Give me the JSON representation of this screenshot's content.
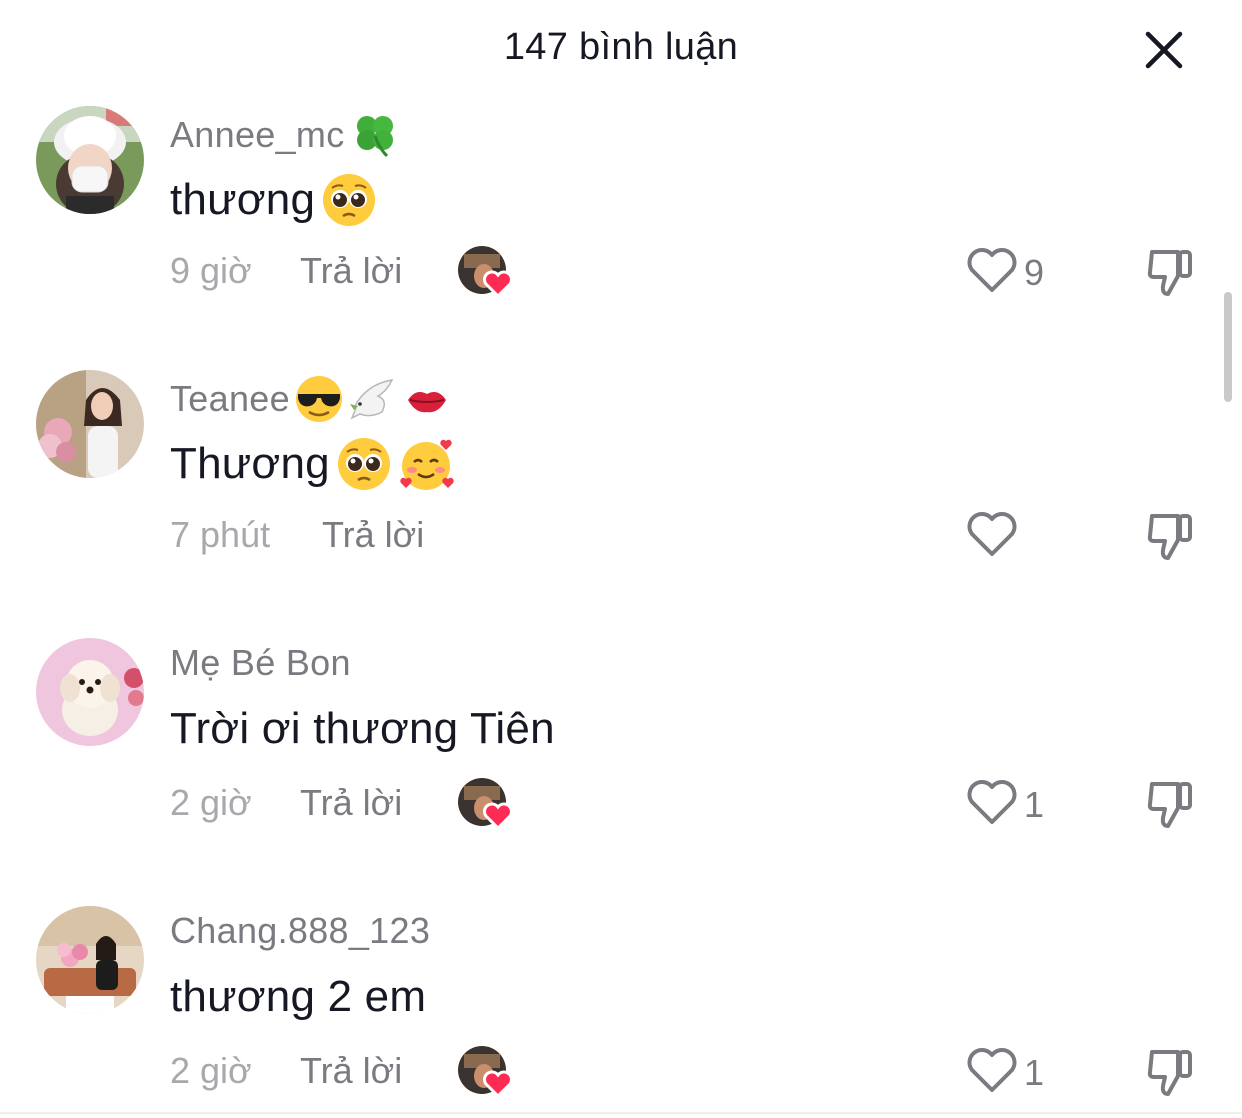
{
  "header": {
    "title": "147 bình luận",
    "close_icon": "close-icon"
  },
  "comments": [
    {
      "username": "Annee_mc",
      "username_emoji": [
        "four-leaf-clover"
      ],
      "text": "thương",
      "text_emoji": [
        "pleading-face"
      ],
      "time": "9 giờ",
      "reply_label": "Trả lời",
      "liked_by_creator": true,
      "like_count": "9"
    },
    {
      "username": "Teanee",
      "username_emoji": [
        "sunglasses-face",
        "dove",
        "kiss-mark"
      ],
      "text": "Thương",
      "text_emoji": [
        "pleading-face",
        "smiling-face-with-hearts"
      ],
      "time": "7 phút",
      "reply_label": "Trả lời",
      "liked_by_creator": false,
      "like_count": ""
    },
    {
      "username": "Mẹ Bé Bon",
      "username_emoji": [],
      "text": "Trời ơi thương Tiên",
      "text_emoji": [],
      "time": "2 giờ",
      "reply_label": "Trả lời",
      "liked_by_creator": true,
      "like_count": "1"
    },
    {
      "username": "Chang.888_123",
      "username_emoji": [],
      "text": "thương 2 em",
      "text_emoji": [],
      "time": "2 giờ",
      "reply_label": "Trả lời",
      "liked_by_creator": true,
      "like_count": "1"
    }
  ],
  "colors": {
    "text_primary": "#161823",
    "text_secondary": "#7a7a80",
    "text_muted": "#a8a8ad",
    "heart_red": "#fe2c55"
  }
}
